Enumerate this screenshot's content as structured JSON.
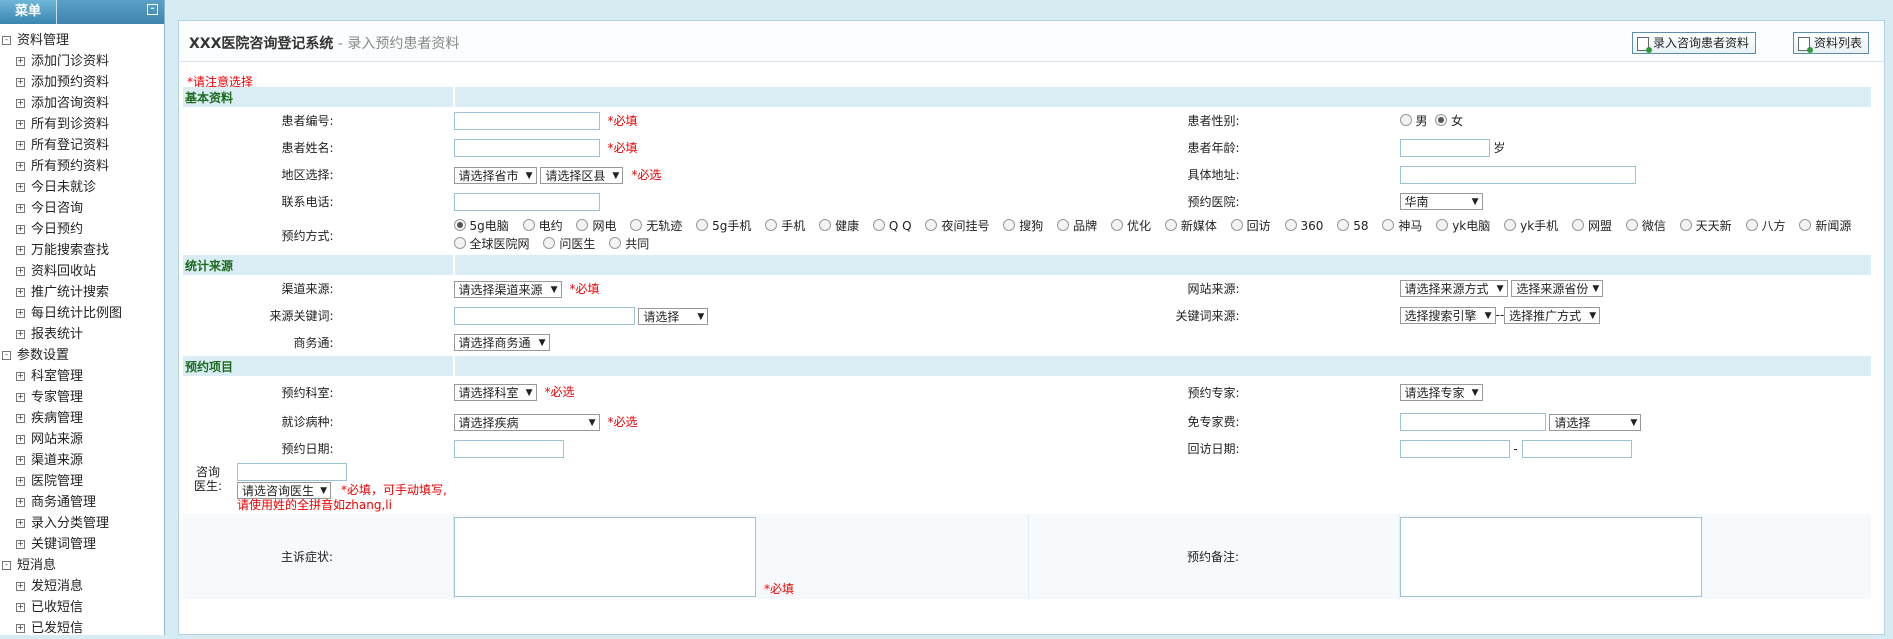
{
  "menu": {
    "tab": "菜单",
    "collapse": "-"
  },
  "sidebar": {
    "groups": [
      {
        "label": "资料管理",
        "items": [
          "添加门诊资料",
          "添加预约资料",
          "添加咨询资料",
          "所有到诊资料",
          "所有登记资料",
          "所有预约资料",
          "今日未就诊",
          "今日咨询",
          "今日预约",
          "万能搜索查找",
          "资料回收站",
          "推广统计搜索",
          "每日统计比例图",
          "报表统计"
        ]
      },
      {
        "label": "参数设置",
        "items": [
          "科室管理",
          "专家管理",
          "疾病管理",
          "网站来源",
          "渠道来源",
          "医院管理",
          "商务通管理",
          "录入分类管理",
          "关键词管理"
        ]
      },
      {
        "label": "短消息",
        "items": [
          "发短消息",
          "已收短信",
          "已发短信"
        ]
      }
    ]
  },
  "header": {
    "title": "XXX医院咨询登记系统",
    "subtitle": " - 录入预约患者资料",
    "btn_enter": "录入咨询患者资料",
    "btn_list": "资料列表"
  },
  "note": "*请注意选择",
  "sections": {
    "basic": "基本资料",
    "stats": "统计来源",
    "booking": "预约项目"
  },
  "basic": {
    "patient_no": "患者编号:",
    "gender": "患者性别:",
    "male": "男",
    "female": "女",
    "name": "患者姓名:",
    "age": "患者年龄:",
    "age_unit": "岁",
    "region": "地区选择:",
    "province": "请选择省市",
    "county": "请选择区县",
    "address": "具体地址:",
    "phone": "联系电话:",
    "hospital": "预约医院:",
    "hospital_value": "华南",
    "method": "预约方式:",
    "methods": [
      "5g电脑",
      "电约",
      "网电",
      "无轨迹",
      "5g手机",
      "手机",
      "健康",
      "Q Q",
      "夜间挂号",
      "搜狗",
      "品牌",
      "优化",
      "新媒体",
      "回访",
      "360",
      "58",
      "神马",
      "yk电脑",
      "yk手机",
      "网盟",
      "微信",
      "天天新",
      "八方",
      "新闻源",
      "全球医院网",
      "问医生",
      "共同"
    ],
    "required": "*必填",
    "select_required": "*必选"
  },
  "stats": {
    "channel": "渠道来源:",
    "channel_sel": "请选择渠道来源",
    "site": "网站来源:",
    "site_sel": "请选择来源方式",
    "province_sel": "选择来源省份",
    "keyword": "来源关键词:",
    "keyword_sel": "请选择",
    "kw_source": "关键词来源:",
    "engine_sel": "选择搜索引擎",
    "dash": "--",
    "promo_sel": "选择推广方式",
    "biz": "商务通:",
    "biz_sel": "请选择商务通"
  },
  "booking": {
    "dept": "预约科室:",
    "dept_sel": "请选择科室",
    "expert": "预约专家:",
    "expert_sel": "请选择专家",
    "disease": "就诊病种:",
    "disease_sel": "请选择疾病",
    "fee": "免专家费:",
    "fee_sel": "请选择",
    "date": "预约日期:",
    "revisit": "回访日期:",
    "range_dash": "-",
    "doctor": "咨询医生:",
    "doctor_sel": "请选咨询医生",
    "doctor_note": "*必填，可手动填写,请使用姓的全拼音如zhang,li",
    "complaint": "主诉症状:",
    "remark": "预约备注:"
  }
}
